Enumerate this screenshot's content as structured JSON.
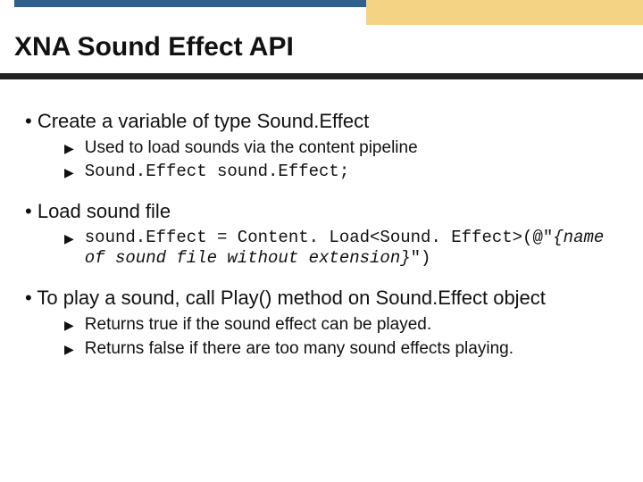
{
  "title": "XNA Sound Effect API",
  "section1": {
    "heading": "Create a variable of type Sound.Effect",
    "sub1": "Used to load sounds via the content pipeline",
    "sub2": "Sound.Effect sound.Effect;"
  },
  "section2": {
    "heading": "Load sound file",
    "sub1_code": "sound.Effect = Content. Load<Sound. Effect>(@\"",
    "sub1_ital": "{name of sound file without extension}",
    "sub1_tail": "\")"
  },
  "section3": {
    "heading": "To play a sound, call Play() method on Sound.Effect object",
    "sub1": "Returns true if the sound effect can be played.",
    "sub2": "Returns false if there are too many sound effects playing."
  }
}
